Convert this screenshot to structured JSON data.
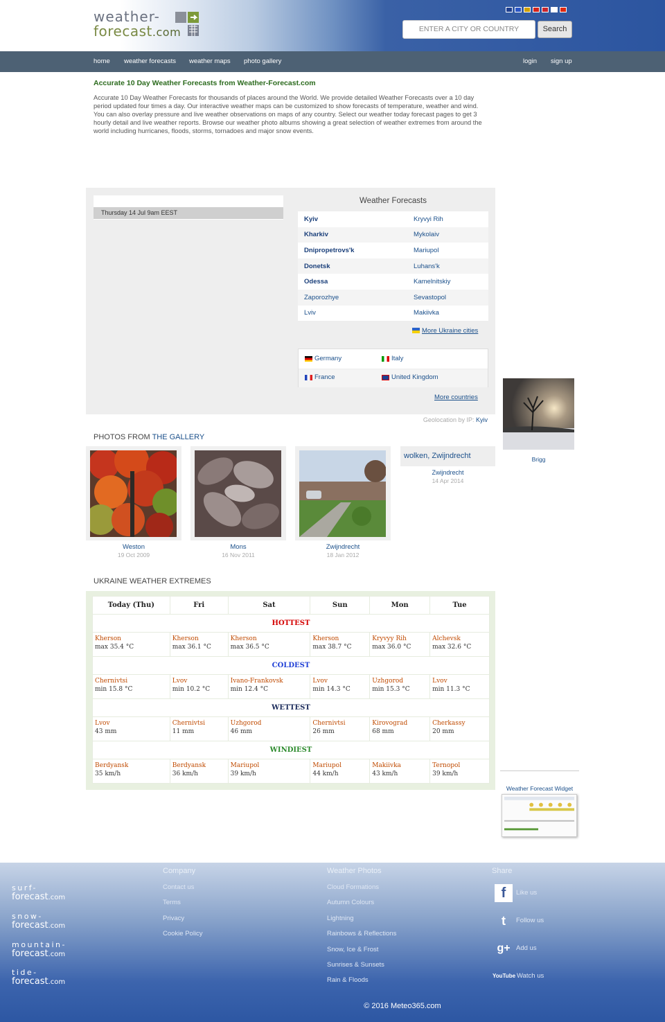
{
  "header": {
    "logo_line1": "weather-",
    "logo_line2": "forecast",
    "logo_suffix": ".com",
    "flags": [
      {
        "name": "uk-flag",
        "color": "#1f3f8f"
      },
      {
        "name": "fr-flag",
        "color": "#2a56c6"
      },
      {
        "name": "de-flag",
        "color": "#d0a000"
      },
      {
        "name": "es-flag",
        "color": "#d4241c"
      },
      {
        "name": "nl-flag",
        "color": "#c8262f"
      },
      {
        "name": "jp-flag",
        "color": "#ffffff"
      },
      {
        "name": "cn-flag",
        "color": "#de2910"
      }
    ],
    "search_placeholder": "ENTER A CITY OR COUNTRY",
    "search_button": "Search"
  },
  "nav": {
    "items": [
      "home",
      "weather forecasts",
      "weather maps",
      "photo gallery"
    ],
    "login": "login",
    "signup": "sign up"
  },
  "intro": {
    "title": "Accurate 10 Day Weather Forecasts from Weather-Forecast.com",
    "text": "Accurate 10 Day Weather Forecasts for thousands of places around the World. We provide detailed Weather Forecasts over a 10 day period updated four times a day. Our interactive weather maps can be customized to show forecasts of temperature, weather and wind. You can also overlay pressure and live weather observations on maps of any country. Select our weather today forecast pages to get 3 hourly detail and live weather reports. Browse our weather photo albums showing a great selection of weather extremes from around the world including hurricanes, floods, storms, tornadoes and major snow events."
  },
  "forecast_panel": {
    "map_date": "Thursday 14 Jul 9am EEST",
    "title": "Weather Forecasts",
    "cities": [
      [
        "Kyiv",
        "Kryvyi Rih"
      ],
      [
        "Kharkiv",
        "Mykolaiv"
      ],
      [
        "Dnipropetrovs'k",
        "Mariupol"
      ],
      [
        "Donetsk",
        "Luhans'k"
      ],
      [
        "Odessa",
        "Kamelnitskiy"
      ],
      [
        "Zaporozhye",
        "Sevastopol"
      ],
      [
        "Lviv",
        "Makiivka"
      ]
    ],
    "more_cities": "More Ukraine cities",
    "countries": [
      "Germany",
      "Italy",
      "France",
      "United Kingdom"
    ],
    "more_countries": "More countries",
    "geoloc_label": "Geolocation by IP:",
    "geoloc_city": "Kyiv"
  },
  "gallery": {
    "title_prefix": "PHOTOS FROM",
    "title_link": "THE GALLERY",
    "items": [
      {
        "caption": "Weston",
        "date": "19 Oct 2009"
      },
      {
        "caption": "Mons",
        "date": "16 Nov 2011"
      },
      {
        "caption": "Zwijndrecht",
        "date": "18 Jan 2012"
      }
    ],
    "text_item": {
      "title": "wolken, Zwijndrecht",
      "caption": "Zwijndrecht",
      "date": "14 Apr 2014"
    },
    "side_photo_caption": "Brigg"
  },
  "extremes": {
    "title": "UKRAINE WEATHER EXTREMES",
    "days": [
      "Today (Thu)",
      "Fri",
      "Sat",
      "Sun",
      "Mon",
      "Tue"
    ],
    "sections": [
      {
        "label": "HOTTEST",
        "color": "#d40000",
        "cells": [
          [
            "Kherson",
            "max 35.4 °C"
          ],
          [
            "Kherson",
            "max 36.1 °C"
          ],
          [
            "Kherson",
            "max 36.5 °C"
          ],
          [
            "Kherson",
            "max 38.7 °C"
          ],
          [
            "Kryvyy Rih",
            "max 36.0 °C"
          ],
          [
            "Alchevsk",
            "max 32.6 °C"
          ]
        ]
      },
      {
        "label": "COLDEST",
        "color": "#1f3fd6",
        "cells": [
          [
            "Chernivtsi",
            "min 15.8 °C"
          ],
          [
            "Lvov",
            "min 10.2 °C"
          ],
          [
            "Ivano-Frankovsk",
            "min 12.4 °C"
          ],
          [
            "Lvov",
            "min 14.3 °C"
          ],
          [
            "Uzhgorod",
            "min 15.3 °C"
          ],
          [
            "Lvov",
            "min 11.3 °C"
          ]
        ]
      },
      {
        "label": "WETTEST",
        "color": "#1a2a5a",
        "cells": [
          [
            "Lvov",
            "43 mm"
          ],
          [
            "Chernivtsi",
            "11 mm"
          ],
          [
            "Uzhgorod",
            "46 mm"
          ],
          [
            "Chernivtsi",
            "26 mm"
          ],
          [
            "Kirovograd",
            "68 mm"
          ],
          [
            "Cherkassy",
            "20 mm"
          ]
        ]
      },
      {
        "label": "WINDIEST",
        "color": "#2b8a2b",
        "cells": [
          [
            "Berdyansk",
            "35 km/h"
          ],
          [
            "Berdyansk",
            "36 km/h"
          ],
          [
            "Mariupol",
            "39 km/h"
          ],
          [
            "Mariupol",
            "44 km/h"
          ],
          [
            "Makiivka",
            "43 km/h"
          ],
          [
            "Ternopol",
            "39 km/h"
          ]
        ]
      }
    ]
  },
  "widget": {
    "title": "Weather Forecast Widget"
  },
  "footer": {
    "logos": [
      {
        "l1": "surf-",
        "l2": "forecast",
        "suffix": ".com"
      },
      {
        "l1": "snow-",
        "l2": "forecast",
        "suffix": ".com"
      },
      {
        "l1": "mountain-",
        "l2": "forecast",
        "suffix": ".com"
      },
      {
        "l1": "tide-",
        "l2": "forecast",
        "suffix": ".com"
      }
    ],
    "company_title": "Company",
    "company_links": [
      "Contact us",
      "Terms",
      "Privacy",
      "Cookie Policy"
    ],
    "photos_title": "Weather Photos",
    "photos_links": [
      "Cloud Formations",
      "Autumn Colours",
      "Lightning",
      "Rainbows & Reflections",
      "Snow, Ice & Frost",
      "Sunrises & Sunsets",
      "Rain & Floods"
    ],
    "share_title": "Share",
    "share": [
      {
        "icon": "facebook-icon",
        "glyph": "f",
        "label": "Like us"
      },
      {
        "icon": "twitter-icon",
        "glyph": "t",
        "label": "Follow us"
      },
      {
        "icon": "google-plus-icon",
        "glyph": "g+",
        "label": "Add us"
      },
      {
        "icon": "youtube-icon",
        "glyph": "YouTube",
        "label": "Watch us"
      }
    ],
    "copyright": "© 2016 Meteo365.com"
  }
}
